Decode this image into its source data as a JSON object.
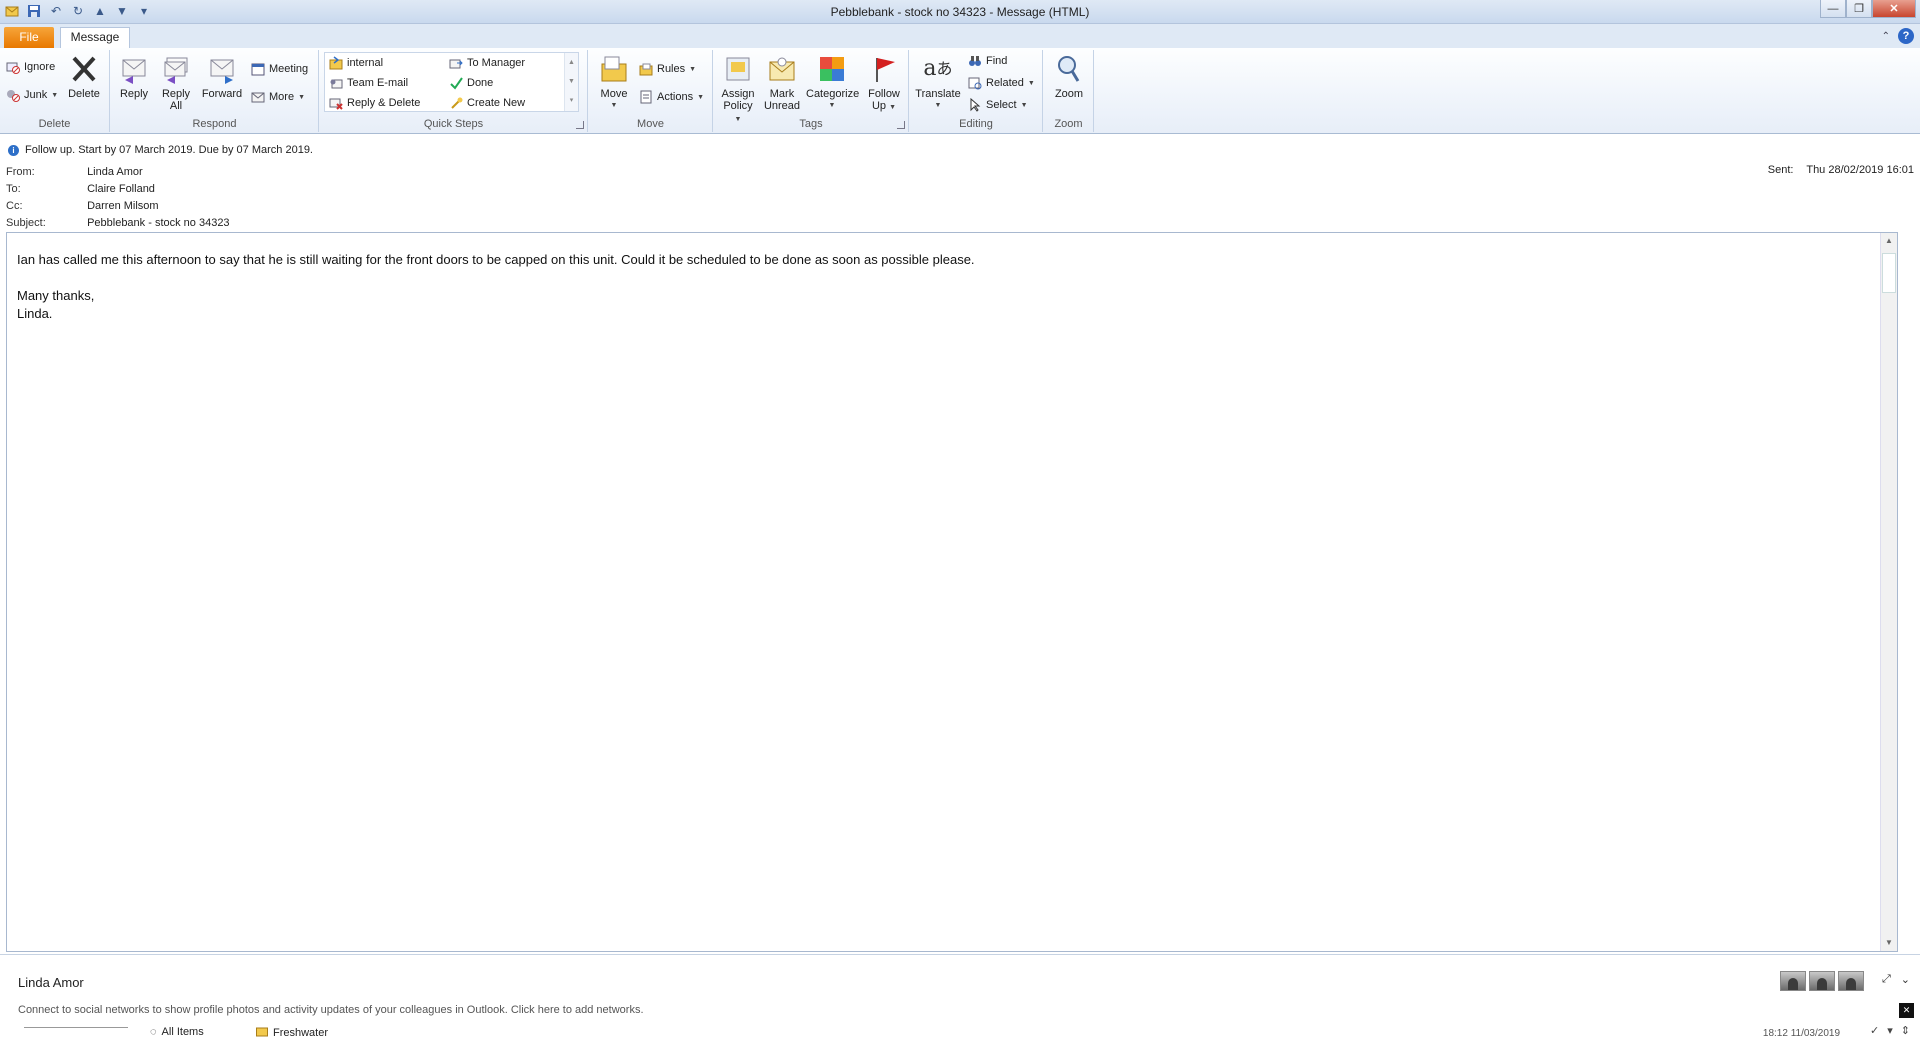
{
  "window": {
    "title": "Pebblebank - stock no 34323  -  Message (HTML)"
  },
  "tabs": {
    "file": "File",
    "message": "Message"
  },
  "ribbon": {
    "delete_group": {
      "label": "Delete",
      "ignore": "Ignore",
      "junk": "Junk",
      "delete": "Delete"
    },
    "respond_group": {
      "label": "Respond",
      "reply": "Reply",
      "reply_all_1": "Reply",
      "reply_all_2": "All",
      "forward": "Forward",
      "meeting": "Meeting",
      "more": "More"
    },
    "quick_steps_group": {
      "label": "Quick Steps",
      "items": [
        "internal",
        "Team E-mail",
        "Reply & Delete",
        "To Manager",
        "Done",
        "Create New"
      ]
    },
    "move_group": {
      "label": "Move",
      "move": "Move",
      "rules": "Rules",
      "actions": "Actions"
    },
    "tags_group": {
      "label": "Tags",
      "assign_policy_1": "Assign",
      "assign_policy_2": "Policy",
      "mark_unread_1": "Mark",
      "mark_unread_2": "Unread",
      "categorize": "Categorize",
      "follow_up_1": "Follow",
      "follow_up_2": "Up"
    },
    "editing_group": {
      "label": "Editing",
      "translate": "Translate",
      "find": "Find",
      "related": "Related",
      "select": "Select"
    },
    "zoom_group": {
      "label": "Zoom",
      "zoom": "Zoom"
    }
  },
  "header": {
    "info": "Follow up.  Start by 07 March 2019.  Due by 07 March 2019.",
    "from_label": "From:",
    "from": "Linda Amor",
    "to_label": "To:",
    "to": "Claire Folland",
    "cc_label": "Cc:",
    "cc": "Darren Milsom",
    "subject_label": "Subject:",
    "subject": "Pebblebank - stock no 34323",
    "sent_label": "Sent:",
    "sent": "Thu 28/02/2019 16:01"
  },
  "body": {
    "line1": "Ian has called me this afternoon to say that he is still waiting for the front doors to be capped on this unit.  Could it be scheduled to be done as soon as possible please.",
    "line2": "",
    "line3": "Many thanks,",
    "line4": "Linda."
  },
  "people_pane": {
    "name": "Linda Amor",
    "message": "Connect to social networks to show profile photos and activity updates of your colleagues in Outlook. Click here to add networks.",
    "all_items": "All Items",
    "freshwater": "Freshwater",
    "timestamp": "18:12  11/03/2019"
  },
  "colors": {
    "file_tab": "#e87800",
    "ribbon_bg": "#e7eef8",
    "follow_flag": "#d42020"
  }
}
